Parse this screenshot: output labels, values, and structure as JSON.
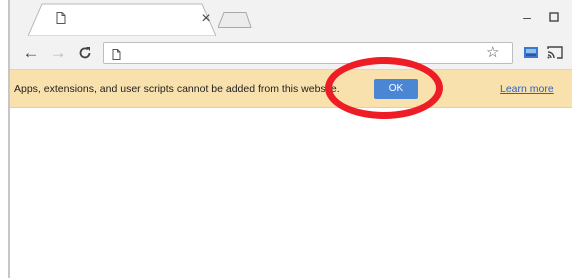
{
  "tab": {
    "title": ""
  },
  "icons": {
    "page": "page-icon",
    "close": "close-icon",
    "newtab": "new-tab-icon",
    "minimize": "minimize-icon",
    "maximize": "maximize-icon",
    "back": "back-arrow-icon",
    "forward": "forward-arrow-icon",
    "reload": "reload-icon",
    "star": "star-icon",
    "extension": "extension-icon",
    "cast": "cast-icon"
  },
  "address_bar": {
    "value": ""
  },
  "infobar": {
    "message": "Apps, extensions, and user scripts cannot be added from this website.",
    "ok_label": "OK",
    "learn_more_label": "Learn more"
  },
  "colors": {
    "infobar_bg": "#f9e1ad",
    "ok_button": "#4a86d4",
    "link": "#2a62c9",
    "highlight_circle": "#ee1c25"
  }
}
